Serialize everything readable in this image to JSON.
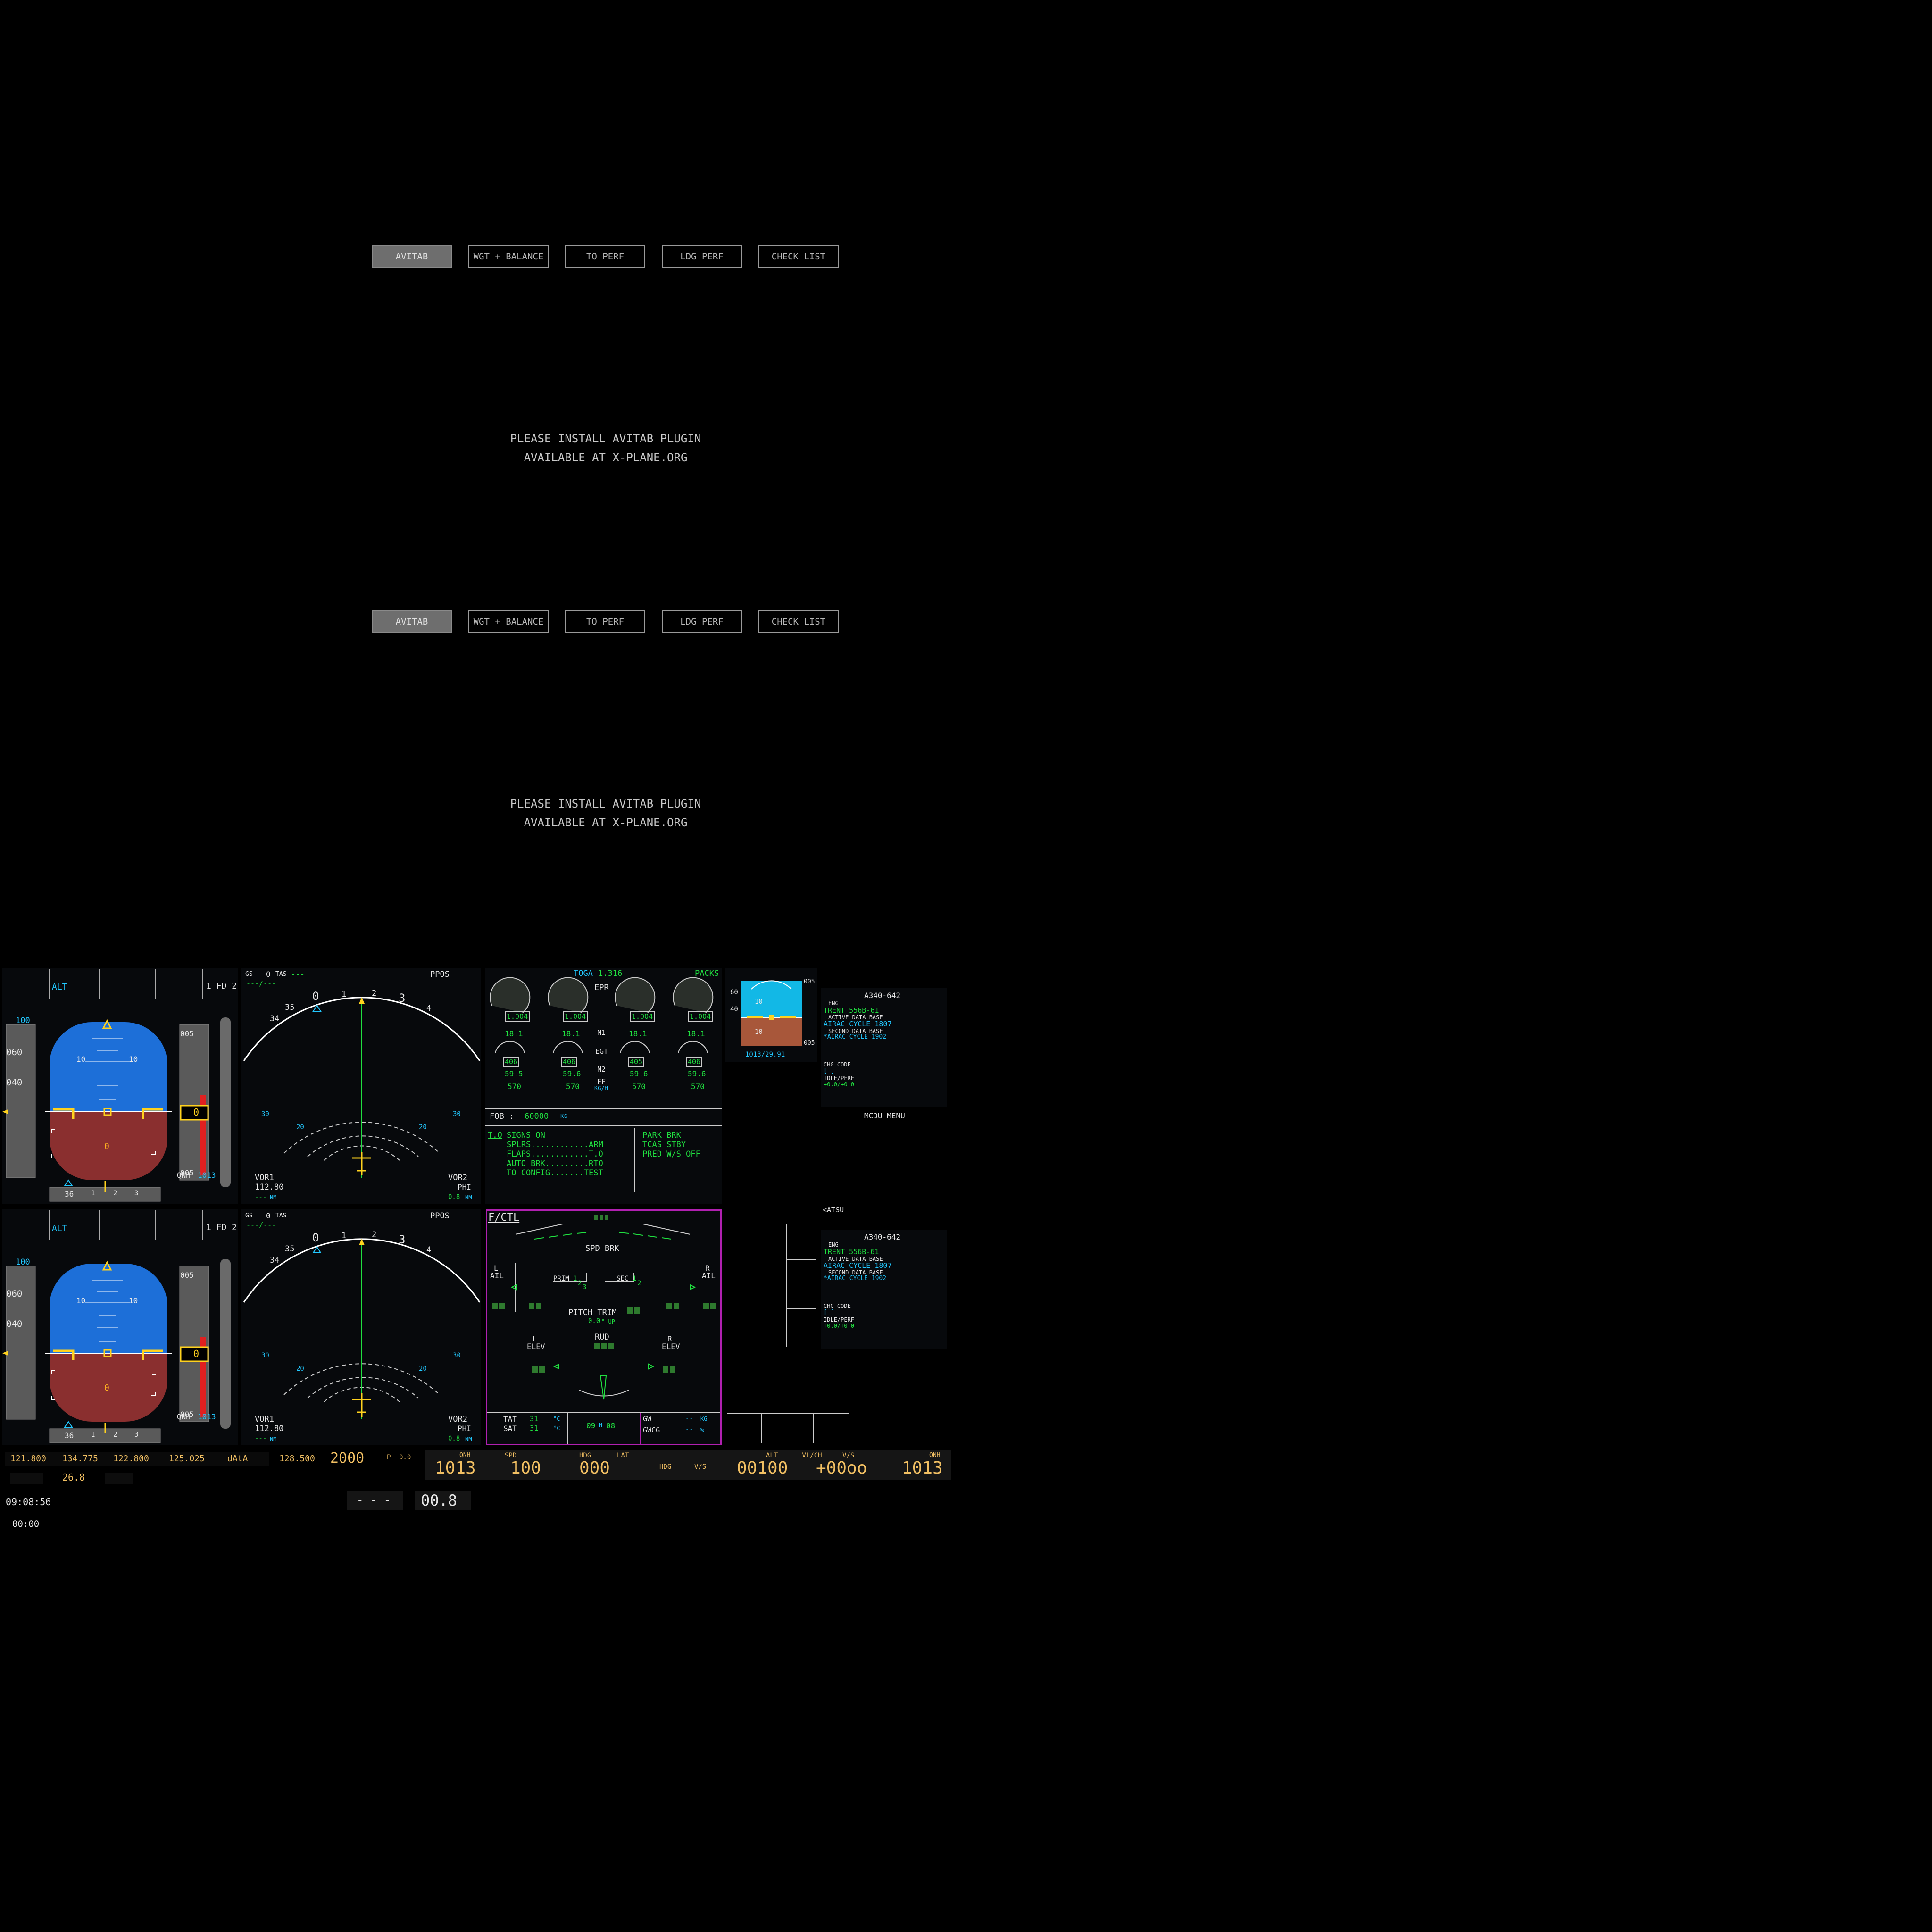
{
  "efb": [
    {
      "tabs": [
        "AVITAB",
        "WGT + BALANCE",
        "TO PERF",
        "LDG PERF",
        "CHECK LIST"
      ],
      "message": [
        "PLEASE INSTALL AVITAB PLUGIN",
        "AVAILABLE AT X-PLANE.ORG"
      ]
    },
    {
      "tabs": [
        "AVITAB",
        "WGT + BALANCE",
        "TO PERF",
        "LDG PERF",
        "CHECK LIST"
      ],
      "message": [
        "PLEASE INSTALL AVITAB PLUGIN",
        "AVAILABLE AT X-PLANE.ORG"
      ]
    }
  ],
  "pfd": [
    {
      "fma_alt": "ALT",
      "fd": "1 FD 2",
      "alt_ref": "100",
      "alt_060": "060",
      "alt_040": "040",
      "alt_005a": "005",
      "alt_005b": "005",
      "alt_current": "0",
      "pitch_10": "10",
      "radio_alt": "0",
      "qnh_label": "QNH",
      "qnh_value": "1013",
      "hdg_ticks": [
        "36",
        "1",
        "2",
        "3"
      ]
    },
    {
      "fma_alt": "ALT",
      "fd": "1 FD 2",
      "alt_ref": "100",
      "alt_060": "060",
      "alt_040": "040",
      "alt_005a": "005",
      "alt_005b": "005",
      "alt_current": "0",
      "pitch_10": "10",
      "radio_alt": "0",
      "qnh_label": "QNH",
      "qnh_value": "1013",
      "hdg_ticks": [
        "36",
        "1",
        "2",
        "3"
      ]
    }
  ],
  "nd": [
    {
      "gs": "GS",
      "gs_val": "0",
      "tas": "TAS",
      "tas_val": "---",
      "wind": "---/---",
      "mode": "PPOS",
      "range_30": "30",
      "range_20": "20",
      "vor1": "VOR1",
      "vor1_freq": "112.80",
      "vor1_dist": "---",
      "vor1_unit": "NM",
      "vor2": "VOR2",
      "vor2_id": "PHI",
      "vor2_dist": "0.8",
      "vor2_unit": "NM",
      "compass": [
        "34",
        "35",
        "0",
        "1",
        "2",
        "3",
        "4"
      ]
    },
    {
      "gs": "GS",
      "gs_val": "0",
      "tas": "TAS",
      "tas_val": "---",
      "wind": "---/---",
      "mode": "PPOS",
      "range_30": "30",
      "range_20": "20",
      "vor1": "VOR1",
      "vor1_freq": "112.80",
      "vor1_dist": "---",
      "vor1_unit": "NM",
      "vor2": "VOR2",
      "vor2_id": "PHI",
      "vor2_dist": "0.8",
      "vor2_unit": "NM",
      "compass": [
        "34",
        "35",
        "0",
        "1",
        "2",
        "3",
        "4"
      ]
    }
  ],
  "ewd": {
    "toga": "TOGA",
    "toga_val": "1.316",
    "packs": "PACKS",
    "epr_label": "EPR",
    "epr_values": [
      "1.004",
      "1.004",
      "1.004",
      "1.004"
    ],
    "n1_label": "N1",
    "n1_values": [
      "18.1",
      "18.1",
      "18.1",
      "18.1"
    ],
    "egt_label": "EGT",
    "egt_values": [
      "406",
      "406",
      "405",
      "406"
    ],
    "n2_label": "N2",
    "n2_values": [
      "59.5",
      "59.6",
      "59.6",
      "59.6"
    ],
    "ff_label": "FF",
    "ff_unit": "KG/H",
    "ff_values": [
      "570",
      "570",
      "570",
      "570"
    ],
    "fob_label": "FOB :",
    "fob_value": "60000",
    "fob_unit": "KG",
    "memo_to": "T.O",
    "memo_left": [
      "SIGNS ON",
      "SPLRS............ARM",
      "FLAPS............T.O",
      "AUTO BRK.........RTO",
      "TO CONFIG.......TEST"
    ],
    "memo_right": [
      "PARK BRK",
      "TCAS STBY",
      "PRED W/S OFF"
    ]
  },
  "isis": {
    "speeds": [
      "60",
      "40"
    ],
    "alts": [
      "005",
      "005"
    ],
    "pitch": "10",
    "baro": "1013/29.91"
  },
  "mcdu": [
    {
      "title": "A340-642",
      "eng_label": "ENG",
      "engine": "TRENT 556B-61",
      "active_db": "ACTIVE DATA BASE",
      "airac1": "AIRAC CYCLE 1807",
      "second_db": "SECOND DATA BASE",
      "airac2": "*AIRAC CYCLE 1902",
      "chg_code": "CHG CODE",
      "chg_val": "[ ]",
      "idle_perf": "IDLE/PERF",
      "idle_val": "+0.0/+0.0"
    },
    {
      "title": "A340-642",
      "eng_label": "ENG",
      "engine": "TRENT 556B-61",
      "active_db": "ACTIVE DATA BASE",
      "airac1": "AIRAC CYCLE 1807",
      "second_db": "SECOND DATA BASE",
      "airac2": "*AIRAC CYCLE 1902",
      "chg_code": "CHG CODE",
      "chg_val": "[ ]",
      "idle_perf": "IDLE/PERF",
      "idle_val": "+0.0/+0.0"
    }
  ],
  "mcdu_menu": "MCDU MENU",
  "atsu": "<ATSU",
  "sd": {
    "title": "F/CTL",
    "spd_brk": "SPD BRK",
    "l_ail": [
      "L",
      "AIL"
    ],
    "r_ail": [
      "R",
      "AIL"
    ],
    "prim": "PRIM",
    "prim_nums": [
      "1",
      "2",
      "3"
    ],
    "sec": "SEC",
    "sec_nums": [
      "1",
      "2"
    ],
    "pitch_trim": "PITCH TRIM",
    "pitch_trim_val": "0.0",
    "pitch_trim_unit": "° UP",
    "rud": "RUD",
    "l_elev": [
      "L",
      "ELEV"
    ],
    "r_elev": [
      "R",
      "ELEV"
    ],
    "tat": "TAT",
    "tat_val": "31",
    "sat": "SAT",
    "sat_val": "31",
    "deg_c": "°C",
    "time_h": "09",
    "time_hsep": "H",
    "time_m": "08",
    "gw": "GW",
    "gw_val": "--",
    "gw_unit": "KG",
    "gwcg": "GWCG",
    "gwcg_val": "--",
    "gwcg_unit": "%"
  },
  "radio": {
    "f1": "121.800",
    "f2": "134.775",
    "f3": "122.800",
    "f4": "125.025",
    "mode": "dAtA",
    "f5": "128.500",
    "xpdr": "2000",
    "f6_label": "P",
    "f6": "0.0",
    "adf": "26.8",
    "chrono": "09:08:56",
    "elapsed": "00:00"
  },
  "fcu": {
    "qnh_label_l": "QNH",
    "qnh_l": "1013",
    "spd_label": "SPD",
    "spd": "100",
    "hdg_label": "HDG",
    "lat_label": "LAT",
    "hdg": "000",
    "hdg_vs": "HDG",
    "vs_label": "V/S",
    "alt_label": "ALT",
    "lvl_ch": "LVL/CH",
    "vs_label2": "V/S",
    "alt": "00100",
    "vs": "+00oo",
    "qnh_label_r": "QNH",
    "qnh_r": "1013",
    "dash": "- - -",
    "value": "00.8"
  }
}
